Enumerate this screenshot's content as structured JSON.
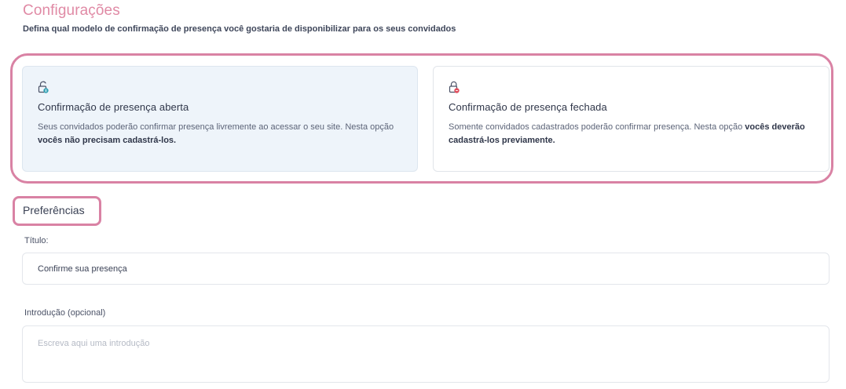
{
  "header": {
    "title": "Configurações",
    "subtitle": "Defina qual modelo de confirmação de presença você gostaria de disponibilizar para os seus convidados"
  },
  "options": [
    {
      "title": "Confirmação de presença aberta",
      "desc_plain": "Seus convidados poderão confirmar presença livremente ao acessar o seu site. Nesta opção ",
      "desc_bold": "vocês não precisam cadastrá-los.",
      "icon": "lock-open-icon",
      "icon_color": "#3fa6b8",
      "selected": true
    },
    {
      "title": "Confirmação de presença fechada",
      "desc_plain": "Somente convidados cadastrados poderão confirmar presença. Nesta opção ",
      "desc_bold": "vocês deverão cadastrá-los previamente.",
      "icon": "lock-closed-icon",
      "icon_color": "#e0505f",
      "selected": false
    }
  ],
  "preferences": {
    "heading": "Preferências",
    "title_label": "Título:",
    "title_value": "Confirme sua presença",
    "intro_label": "Introdução (opcional)",
    "intro_placeholder": "Escreva aqui uma introdução"
  },
  "colors": {
    "accent": "#e08aa5",
    "highlight_border": "#d982a4",
    "selected_card_bg": "#eef4fa"
  }
}
